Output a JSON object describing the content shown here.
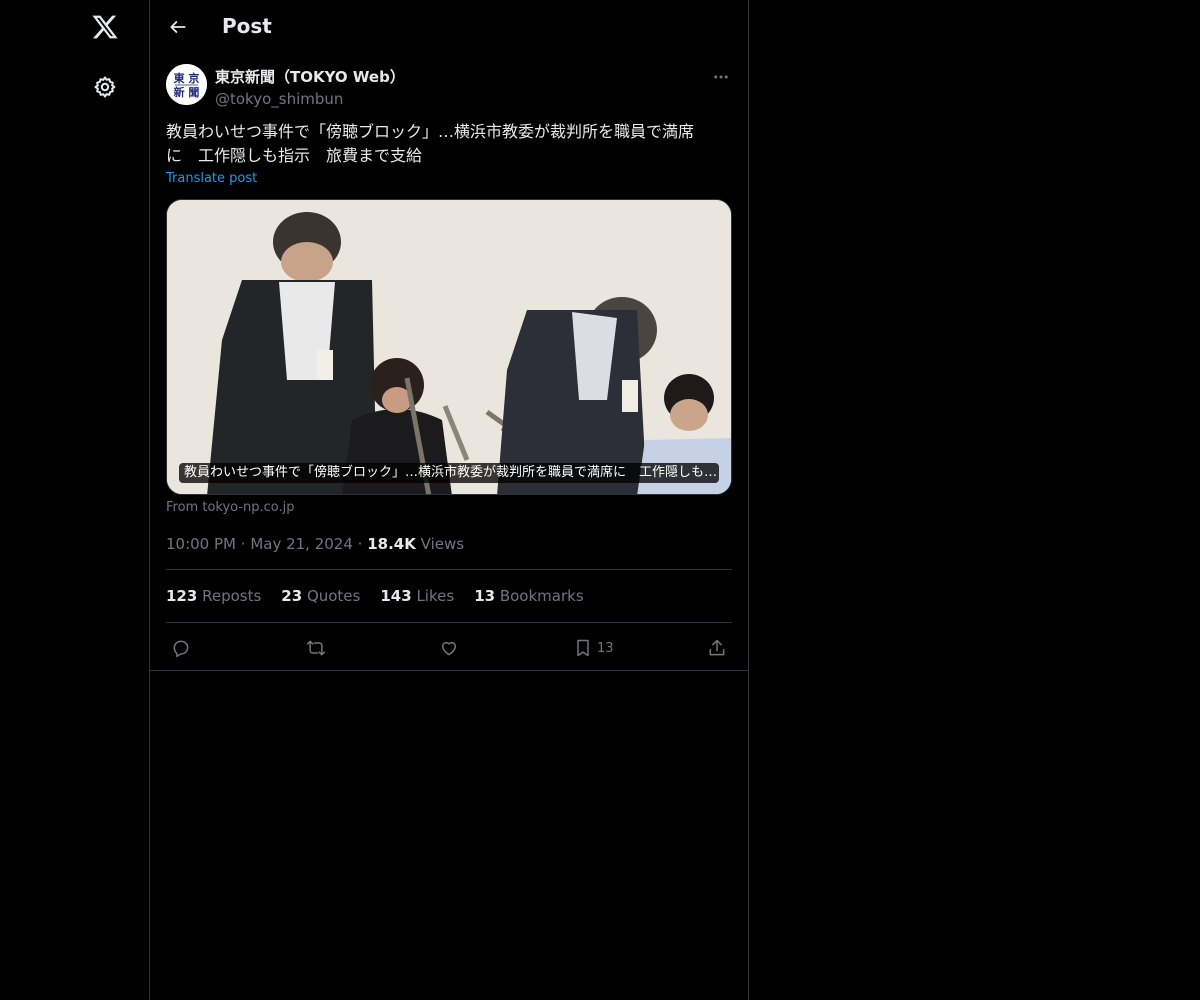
{
  "rail": {
    "logo_icon": "x-logo-icon",
    "settings_icon": "gear-icon"
  },
  "header": {
    "title": "Post",
    "back_icon": "arrow-left-icon"
  },
  "post": {
    "author_name": "東京新聞（TOKYO Web）",
    "author_handle": "@tokyo_shimbun",
    "avatar_text": "東京新聞",
    "text_line1": "教員わいせつ事件で「傍聴ブロック」…横浜市教委が裁判所を職員で満席",
    "text_line2": "に　工作隠しも指示　旅費まで支給",
    "translate_label": "Translate post",
    "media_caption": "教員わいせつ事件で「傍聴ブロック」…横浜市教委が裁判所を職員で満席に　工作隠しも…",
    "source": "From tokyo-np.co.jp",
    "time": "10:00 PM",
    "date": "May 21, 2024",
    "views_count": "18.4K",
    "views_label": "Views"
  },
  "stats": [
    {
      "count": "123",
      "label": "Reposts"
    },
    {
      "count": "23",
      "label": "Quotes"
    },
    {
      "count": "143",
      "label": "Likes"
    },
    {
      "count": "13",
      "label": "Bookmarks"
    }
  ],
  "actions": {
    "reply_icon": "reply-icon",
    "repost_icon": "repost-icon",
    "like_icon": "heart-icon",
    "bookmark_icon": "bookmark-icon",
    "bookmark_count": "13",
    "share_icon": "share-icon"
  },
  "colors": {
    "background": "#000000",
    "text": "#e7e9ea",
    "muted": "#71767b",
    "accent": "#1d9bf0",
    "border": "#2f3336"
  }
}
